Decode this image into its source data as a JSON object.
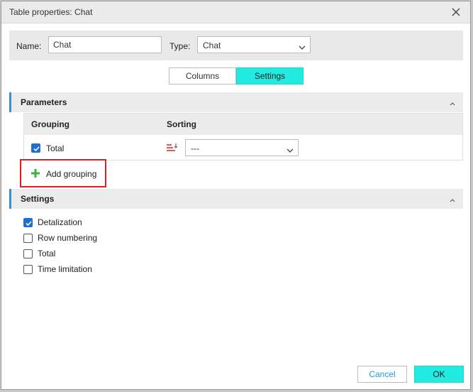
{
  "dialog": {
    "title": "Table properties: Chat"
  },
  "namebar": {
    "name_label": "Name:",
    "name_value": "Chat",
    "type_label": "Type:",
    "type_value": "Chat"
  },
  "tabs": [
    {
      "label": "Columns",
      "active": false
    },
    {
      "label": "Settings",
      "active": true
    }
  ],
  "parameters": {
    "title": "Parameters",
    "columns": {
      "grouping": "Grouping",
      "sorting": "Sorting"
    },
    "rows": [
      {
        "label": "Total",
        "checked": true,
        "sorting": "---"
      }
    ],
    "add_grouping": "Add grouping"
  },
  "settings": {
    "title": "Settings",
    "options": [
      {
        "label": "Detalization",
        "checked": true
      },
      {
        "label": "Row numbering",
        "checked": false
      },
      {
        "label": "Total",
        "checked": false
      },
      {
        "label": "Time limitation",
        "checked": false
      }
    ]
  },
  "buttons": {
    "cancel": "Cancel",
    "ok": "OK"
  },
  "colors": {
    "accent": "#22ece2",
    "section_border": "#3a8fd6",
    "highlight_box": "#d8232a",
    "checkbox": "#1f6fd0",
    "plus": "#3cb043"
  },
  "icons": {
    "close": "close-icon",
    "chevron": "chevron-down-icon",
    "collapse": "chevron-up-icon",
    "sort": "sort-icon",
    "add": "plus-icon",
    "check": "check-icon"
  }
}
